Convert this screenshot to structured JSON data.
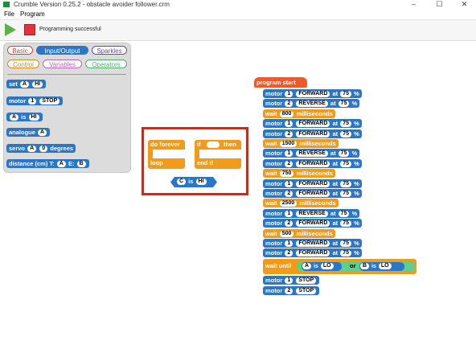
{
  "window": {
    "title": "Crumble Version 0.25.2 - obstacle avoider follower.crm",
    "min": "–",
    "max": "☐",
    "close": "✕"
  },
  "menu": {
    "file": "File",
    "program": "Program"
  },
  "toolbar": {
    "status": "Programming successful",
    "run_icon": "play-icon",
    "stop_icon": "stop-icon",
    "run_color": "#5bb347",
    "stop_color": "#e0333e"
  },
  "palette": {
    "categories": [
      "Basic",
      "Input/Output",
      "Sparkles",
      "Control",
      "Variables",
      "Operators"
    ],
    "blocks": {
      "set": {
        "label": "set",
        "pin": "A",
        "value": "HI"
      },
      "motor": {
        "label": "motor",
        "num": "1",
        "dir": "STOP"
      },
      "pin_is": {
        "pin": "A",
        "is": "is",
        "value": "HI"
      },
      "analogue": {
        "label": "analogue",
        "pin": "A"
      },
      "servo": {
        "label": "servo",
        "pin": "A",
        "value": "0",
        "unit": "degrees"
      },
      "distance": {
        "label": "distance (cm)",
        "t": "T:",
        "pin_t": "A",
        "e": "E:",
        "pin_e": "B"
      }
    }
  },
  "highlight": {
    "do_forever": "do forever",
    "loop": "loop",
    "if": "if",
    "then": "then",
    "end_if": "end if",
    "cond": {
      "pin": "C",
      "is": "is",
      "value": "HI"
    }
  },
  "program": {
    "start": "program start",
    "word_motor": "motor",
    "word_at": "at",
    "word_pct": "%",
    "word_wait": "wait",
    "word_ms": "milliseconds",
    "steps": [
      {
        "kind": "motor",
        "num": "1",
        "dir": "FORWARD",
        "speed": "75"
      },
      {
        "kind": "motor",
        "num": "2",
        "dir": "REVERSE",
        "speed": "75"
      },
      {
        "kind": "wait",
        "ms": "800"
      },
      {
        "kind": "motor",
        "num": "1",
        "dir": "FORWARD",
        "speed": "75"
      },
      {
        "kind": "motor",
        "num": "2",
        "dir": "FORWARD",
        "speed": "75"
      },
      {
        "kind": "wait",
        "ms": "1500"
      },
      {
        "kind": "motor",
        "num": "1",
        "dir": "REVERSE",
        "speed": "75"
      },
      {
        "kind": "motor",
        "num": "2",
        "dir": "FORWARD",
        "speed": "75"
      },
      {
        "kind": "wait",
        "ms": "750"
      },
      {
        "kind": "motor",
        "num": "1",
        "dir": "FORWARD",
        "speed": "75"
      },
      {
        "kind": "motor",
        "num": "2",
        "dir": "FORWARD",
        "speed": "75"
      },
      {
        "kind": "wait",
        "ms": "2500"
      },
      {
        "kind": "motor",
        "num": "1",
        "dir": "REVERSE",
        "speed": "75"
      },
      {
        "kind": "motor",
        "num": "2",
        "dir": "FORWARD",
        "speed": "75"
      },
      {
        "kind": "wait",
        "ms": "500"
      },
      {
        "kind": "motor",
        "num": "1",
        "dir": "FORWARD",
        "speed": "75"
      },
      {
        "kind": "motor",
        "num": "2",
        "dir": "FORWARD",
        "speed": "75"
      }
    ],
    "wait_until": {
      "label": "wait until",
      "left_pin": "A",
      "left_is": "is",
      "left_val": "LO",
      "op": "or",
      "right_pin": "B",
      "right_is": "is",
      "right_val": "LO"
    },
    "stops": [
      {
        "num": "1",
        "dir": "STOP"
      },
      {
        "num": "2",
        "dir": "STOP"
      }
    ]
  }
}
